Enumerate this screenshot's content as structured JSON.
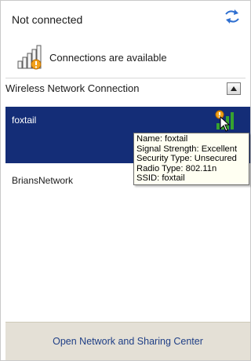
{
  "status": {
    "title": "Not connected"
  },
  "availability": {
    "text": "Connections are available",
    "icon": "signal-bars-warning-icon"
  },
  "section": {
    "title": "Wireless Network Connection",
    "toggle_icon": "collapse-arrow-icon"
  },
  "networks": [
    {
      "name": "foxtail",
      "selected": true,
      "icon": "signal-strength-icon",
      "tooltip": {
        "name": "Name: foxtail",
        "signal": "Signal Strength: Excellent",
        "security": "Security Type: Unsecured",
        "radio": "Radio Type: 802.11n",
        "ssid": "SSID: foxtail"
      }
    },
    {
      "name": "BriansNetwork",
      "selected": false
    }
  ],
  "footer": {
    "link": "Open Network and Sharing Center"
  },
  "colors": {
    "selected_bg": "#142d77",
    "tooltip_bg": "#fffff2",
    "footer_bg": "#e4e0d6",
    "signal_green": "#37a22f",
    "warning_orange": "#f2a11a"
  }
}
